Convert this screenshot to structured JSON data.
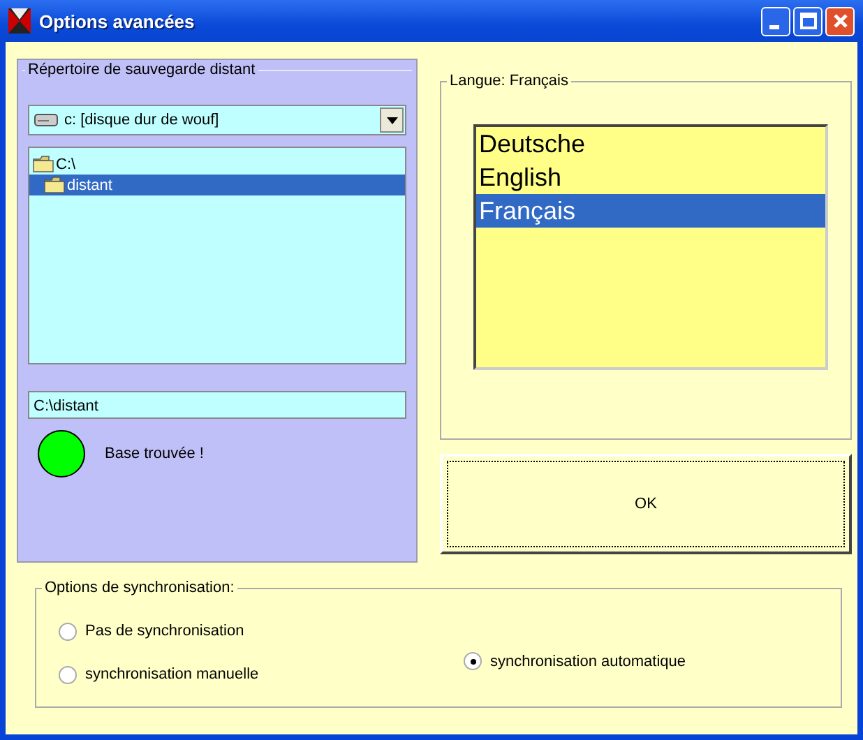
{
  "window": {
    "title": "Options avancées"
  },
  "remote_folder": {
    "title": "Répertoire de sauvegarde distant",
    "drive": "c: [disque dur de wouf]",
    "folders": [
      {
        "label": "C:\\",
        "selected": false,
        "children": [
          {
            "label": "distant",
            "selected": true
          }
        ]
      }
    ],
    "path": "C:\\distant",
    "status": {
      "color": "#00ff00",
      "text": "Base trouvée !"
    }
  },
  "language": {
    "title": "Langue: Français",
    "options": [
      {
        "label": "Deutsche",
        "selected": false
      },
      {
        "label": "English",
        "selected": false
      },
      {
        "label": "Français",
        "selected": true
      }
    ]
  },
  "ok_button": "OK",
  "sync": {
    "title": "Options de synchronisation:",
    "options": [
      {
        "label": "Pas de synchronisation",
        "selected": false
      },
      {
        "label": "synchronisation manuelle",
        "selected": false
      },
      {
        "label": "synchronisation automatique",
        "selected": true
      }
    ]
  }
}
